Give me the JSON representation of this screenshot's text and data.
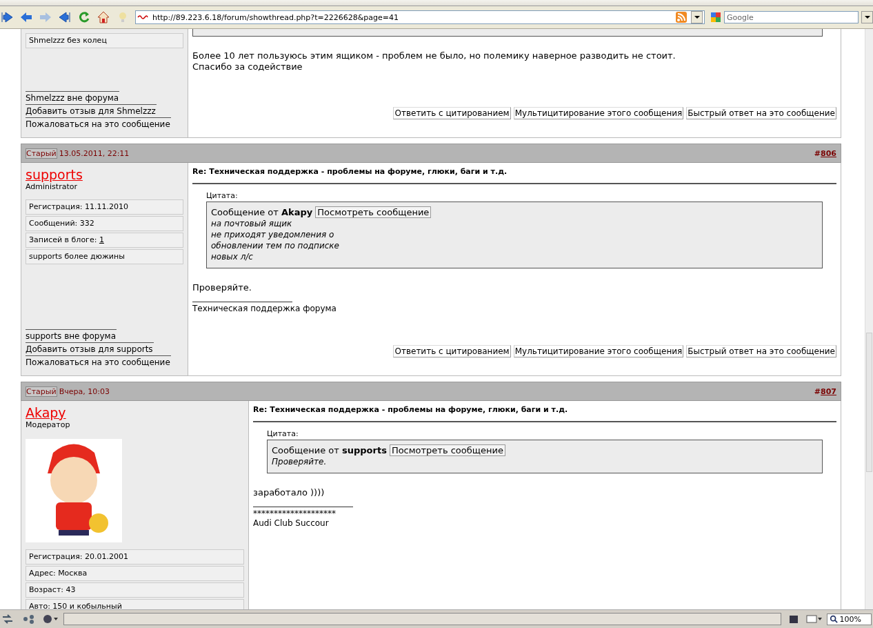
{
  "browser": {
    "url": "http://89.223.6.18/forum/showthread.php?t=2226628&page=41",
    "search_placeholder": "Google",
    "zoom": "100%"
  },
  "posts": [
    {
      "user": {
        "badge": "Shmelzzz без колец",
        "links": [
          "Shmelzzz вне форума",
          "Добавить отзыв для Shmelzzz",
          "Пожаловаться на это сообщение"
        ]
      },
      "message": [
        "Более 10 лет пользуюсь этим ящиком - проблем не было, но полемику наверное разводить не стоит.",
        "Спасибо за содействие"
      ],
      "buttons": [
        "Ответить с цитированием",
        "Мультицитирование этого сообщения",
        "Быстрый ответ на это сообщение"
      ]
    },
    {
      "header": {
        "old_label": "Старый",
        "date": "13.05.2011, 22:11",
        "hash": "#",
        "number": "806"
      },
      "user": {
        "name": "supports",
        "role": "Administrator",
        "avatar": false,
        "stats": [
          {
            "text": "Регистрация: 11.11.2010"
          },
          {
            "text": "Сообщений: 332"
          },
          {
            "text": "Записей в блоге: ",
            "link": "1"
          }
        ],
        "badge": "supports более дюжины",
        "links": [
          "supports вне форума",
          "Добавить отзыв для supports",
          "Пожаловаться на это сообщение"
        ]
      },
      "title": "Re: Техническая поддержка - проблемы на форуме, глюки, баги и т.д.",
      "quote": {
        "label": "Цитата:",
        "prefix": "Сообщение от ",
        "author": "Akapy",
        "view": "Посмотреть сообщение",
        "lines": [
          "на почтовый ящик",
          "не приходят уведомления о",
          "обновлении тем по подписке",
          "новых л/с"
        ]
      },
      "message": [
        "Проверяйте."
      ],
      "signature": [
        "Техническая поддержка форума"
      ],
      "buttons": [
        "Ответить с цитированием",
        "Мультицитирование этого сообщения",
        "Быстрый ответ на это сообщение"
      ]
    },
    {
      "header": {
        "old_label": "Старый",
        "date": "Вчера, 10:03",
        "hash": "#",
        "number": "807"
      },
      "user": {
        "name": "Akapy",
        "role": "Модератор",
        "avatar": true,
        "stats": [
          {
            "text": "Регистрация: 20.01.2001"
          },
          {
            "text": "Адрес: Москва"
          },
          {
            "text": "Возраст: 43"
          },
          {
            "text": "Авто: 150 и кобыльный"
          }
        ]
      },
      "title": "Re: Техническая поддержка - проблемы на форуме, глюки, баги и т.д.",
      "quote": {
        "label": "Цитата:",
        "prefix": "Сообщение от ",
        "author": "supports",
        "view": "Посмотреть сообщение",
        "lines": [
          "Проверяйте."
        ]
      },
      "message": [
        "заработало ))))"
      ],
      "signature": [
        "********************",
        "Audi Club Succour"
      ]
    }
  ]
}
